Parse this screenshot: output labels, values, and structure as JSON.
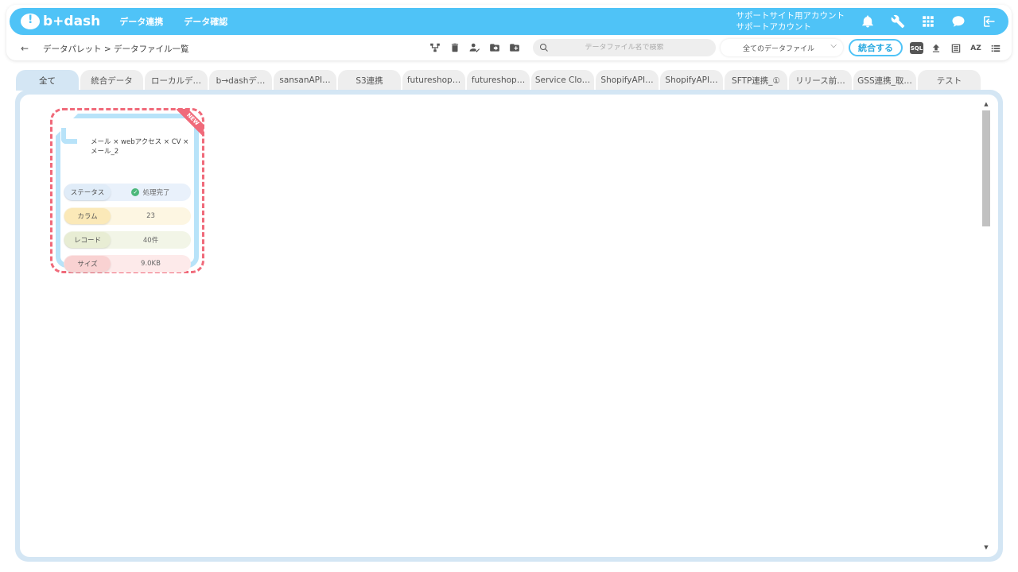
{
  "header": {
    "logo_text": "b+dash",
    "nav": [
      "データ連携",
      "データ確認"
    ],
    "account_line1": "サポートサイト用アカウント",
    "account_line2": "サポートアカウント",
    "icons": [
      "bell-icon",
      "wrench-icon",
      "grid-icon",
      "chat-icon",
      "logout-icon"
    ]
  },
  "subbar": {
    "back_label": "←",
    "breadcrumb": "データパレット > データファイル一覧",
    "search_placeholder": "データファイル名で検索",
    "filter_selected": "全てのデータファイル",
    "merge_label": "統合する",
    "sql_label": "SQL",
    "az_label": "AZ"
  },
  "tabs": [
    "全て",
    "統合データ",
    "ローカルデ…",
    "b→dashデ…",
    "sansanAPI…",
    "S3連携",
    "futureshop…",
    "futureshop…",
    "Service Clo…",
    "ShopifyAPI…",
    "ShopifyAPI…",
    "SFTP連携_①",
    "リリース前…",
    "GSS連携_取…",
    "テスト"
  ],
  "card": {
    "badge": "NEW",
    "name": "メール × webアクセス × CV × メール_2",
    "status_label": "ステータス",
    "status_value": "処理完了",
    "column_label": "カラム",
    "column_value": "23",
    "record_label": "レコード",
    "record_value": "40件",
    "size_label": "サイズ",
    "size_value": "9.0KB"
  },
  "colors": {
    "brand": "#4fc3f7",
    "card_border": "#f06a7a",
    "panel": "#d4e6f4"
  }
}
